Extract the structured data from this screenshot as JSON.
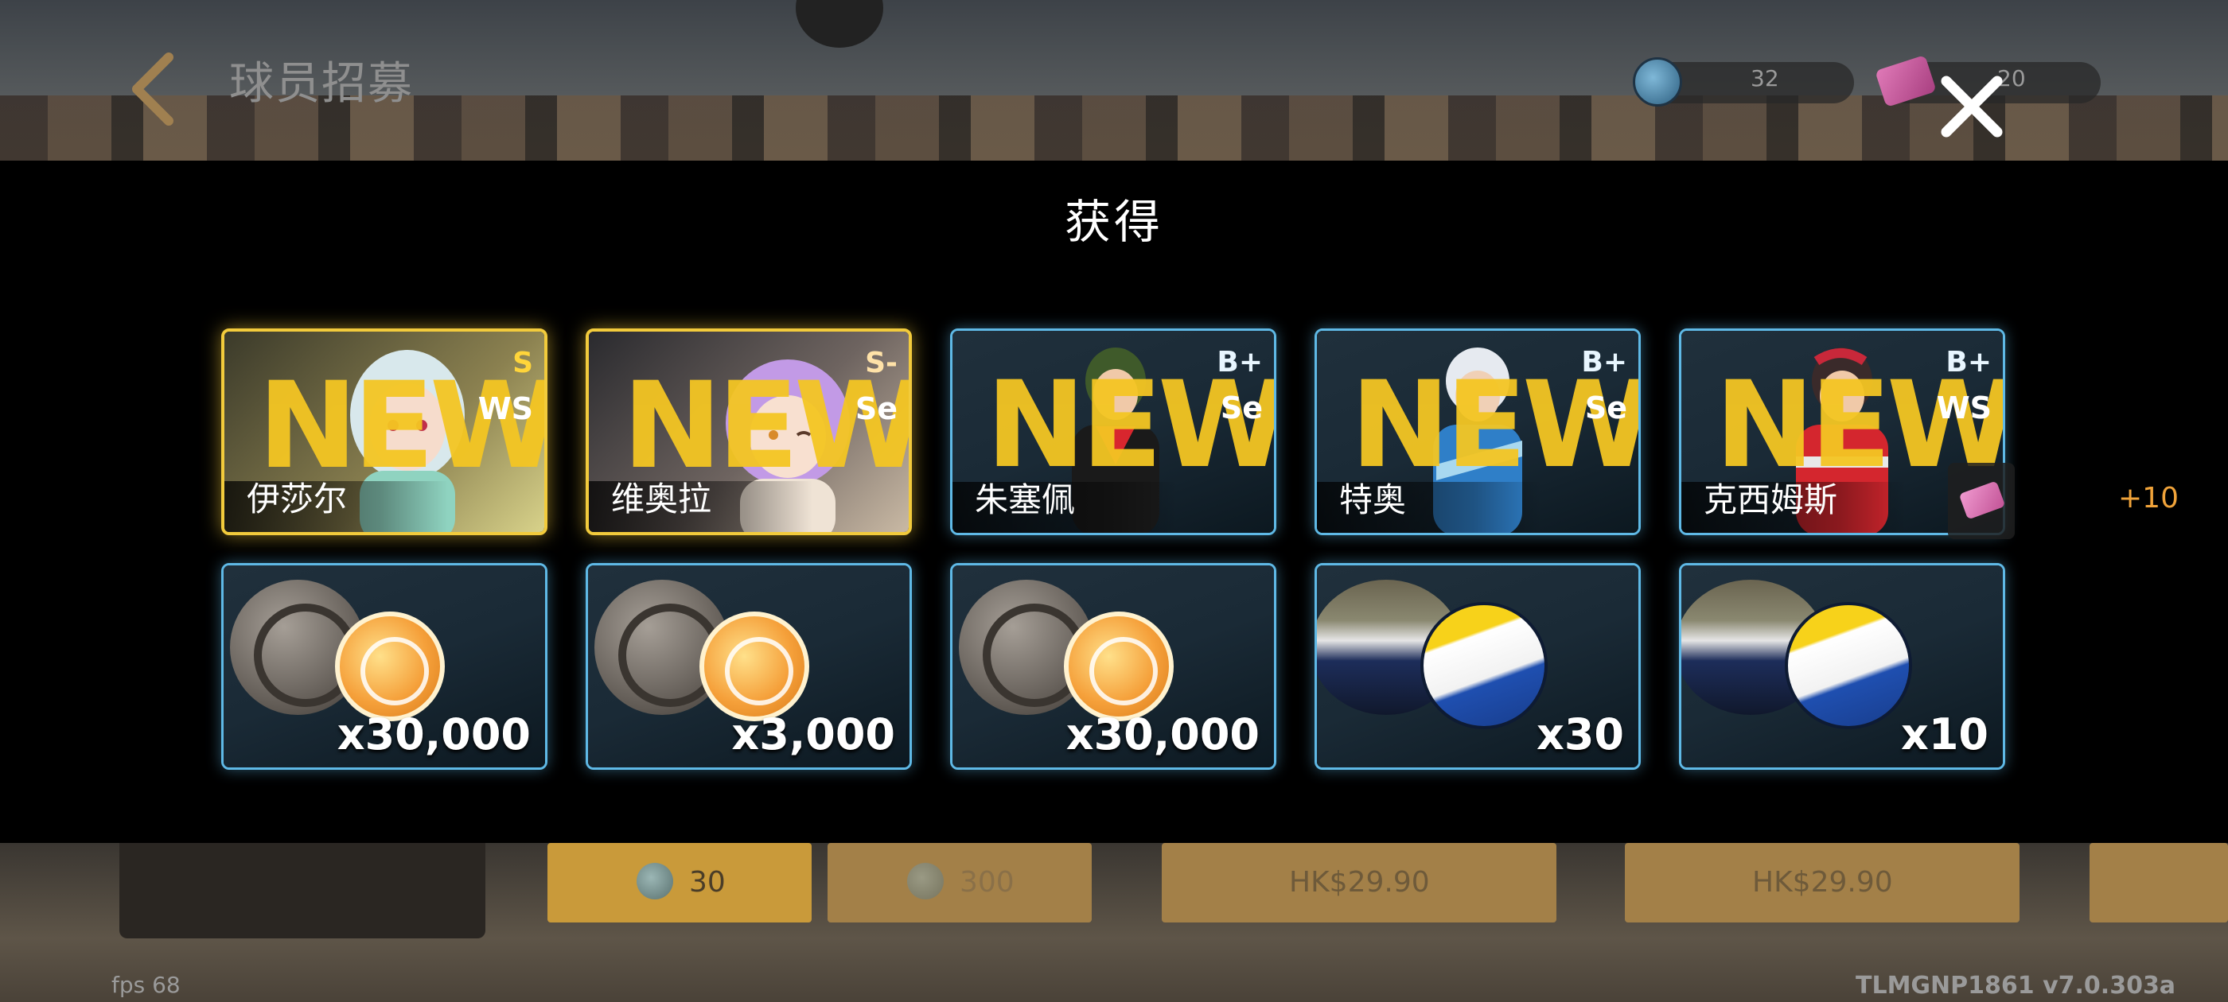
{
  "header": {
    "title": "球员招募",
    "resources": [
      {
        "icon": "drop-icon",
        "value": "32"
      },
      {
        "icon": "ticket-icon",
        "value": "20"
      }
    ]
  },
  "modal": {
    "title": "获得",
    "more_label": "+10",
    "characters": [
      {
        "name": "伊莎尔",
        "rank": "S",
        "position": "WS",
        "new_label": "NEW",
        "frame": "gold"
      },
      {
        "name": "维奥拉",
        "rank": "S-",
        "position": "Se",
        "new_label": "NEW",
        "frame": "gold"
      },
      {
        "name": "朱塞佩",
        "rank": "B+",
        "position": "Se",
        "new_label": "NEW",
        "frame": "blue"
      },
      {
        "name": "特奥",
        "rank": "B+",
        "position": "Se",
        "new_label": "NEW",
        "frame": "blue"
      },
      {
        "name": "克西姆斯",
        "rank": "B+",
        "position": "WS",
        "new_label": "NEW",
        "frame": "blue"
      }
    ],
    "items": [
      {
        "type": "coin",
        "quantity": "x30,000"
      },
      {
        "type": "coin",
        "quantity": "x3,000"
      },
      {
        "type": "coin",
        "quantity": "x30,000"
      },
      {
        "type": "volleyball",
        "quantity": "x30"
      },
      {
        "type": "volleyball",
        "quantity": "x10"
      }
    ]
  },
  "bottom": {
    "buttons": [
      {
        "label": "30",
        "icon": "drop-icon"
      },
      {
        "label": "300",
        "icon": "drop-icon"
      },
      {
        "label": "HK$29.90"
      },
      {
        "label": "HK$29.90"
      }
    ],
    "fps": "fps 68",
    "build": "TLMGNP1861   v7.0.303a"
  },
  "colors": {
    "gold_frame": "#f2cb3c",
    "blue_frame": "#5fb9e6",
    "new_text": "#f4c623",
    "plus_label": "#f0a33a"
  }
}
